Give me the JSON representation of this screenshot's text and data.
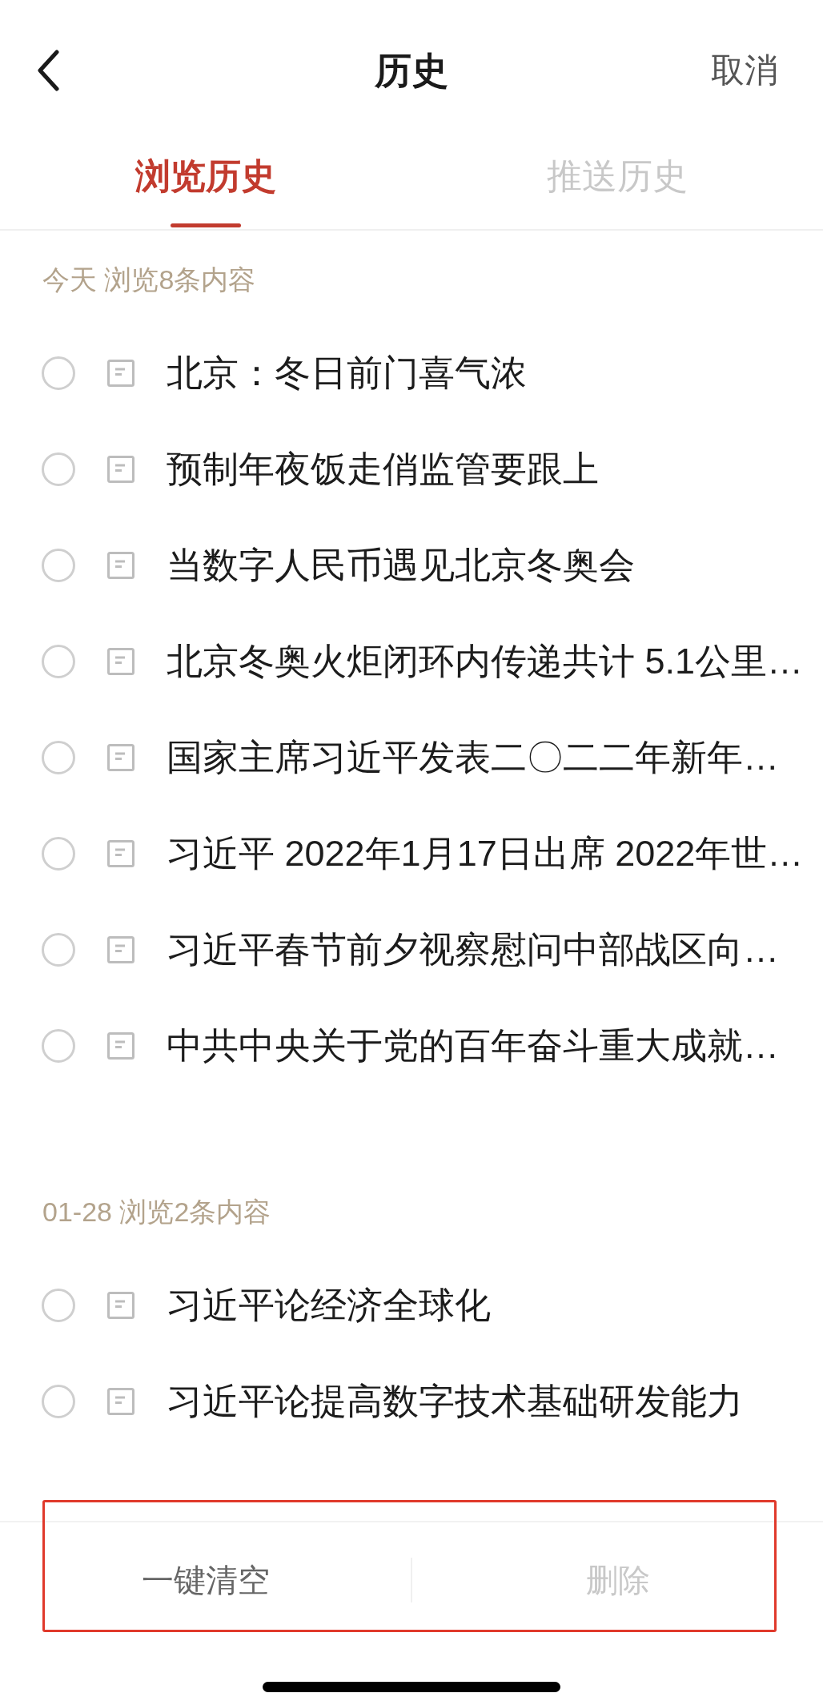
{
  "header": {
    "title": "历史",
    "cancel": "取消"
  },
  "tabs": [
    {
      "label": "浏览历史",
      "selected": true
    },
    {
      "label": "推送历史",
      "selected": false
    }
  ],
  "sections": [
    {
      "heading": "今天 浏览8条内容",
      "items": [
        {
          "title": "北京：冬日前门喜气浓",
          "checked": false
        },
        {
          "title": "预制年夜饭走俏监管要跟上",
          "checked": false
        },
        {
          "title": "当数字人民币遇见北京冬奥会",
          "checked": false
        },
        {
          "title": "北京冬奥火炬闭环内传递共计 5.1公里…",
          "checked": false
        },
        {
          "title": "国家主席习近平发表二〇二二年新年…",
          "checked": false
        },
        {
          "title": "习近平 2022年1月17日出席 2022年世…",
          "checked": false
        },
        {
          "title": "习近平春节前夕视察慰问中部战区向…",
          "checked": false
        },
        {
          "title": "中共中央关于党的百年奋斗重大成就…",
          "checked": false
        }
      ]
    },
    {
      "heading": "01-28 浏览2条内容",
      "items": [
        {
          "title": "习近平论经济全球化",
          "checked": false
        },
        {
          "title": "习近平论提高数字技术基础研发能力",
          "checked": false
        }
      ]
    }
  ],
  "footer": {
    "buttons": [
      {
        "label": "一键清空",
        "disabled": false
      },
      {
        "label": "删除",
        "disabled": true
      }
    ]
  }
}
